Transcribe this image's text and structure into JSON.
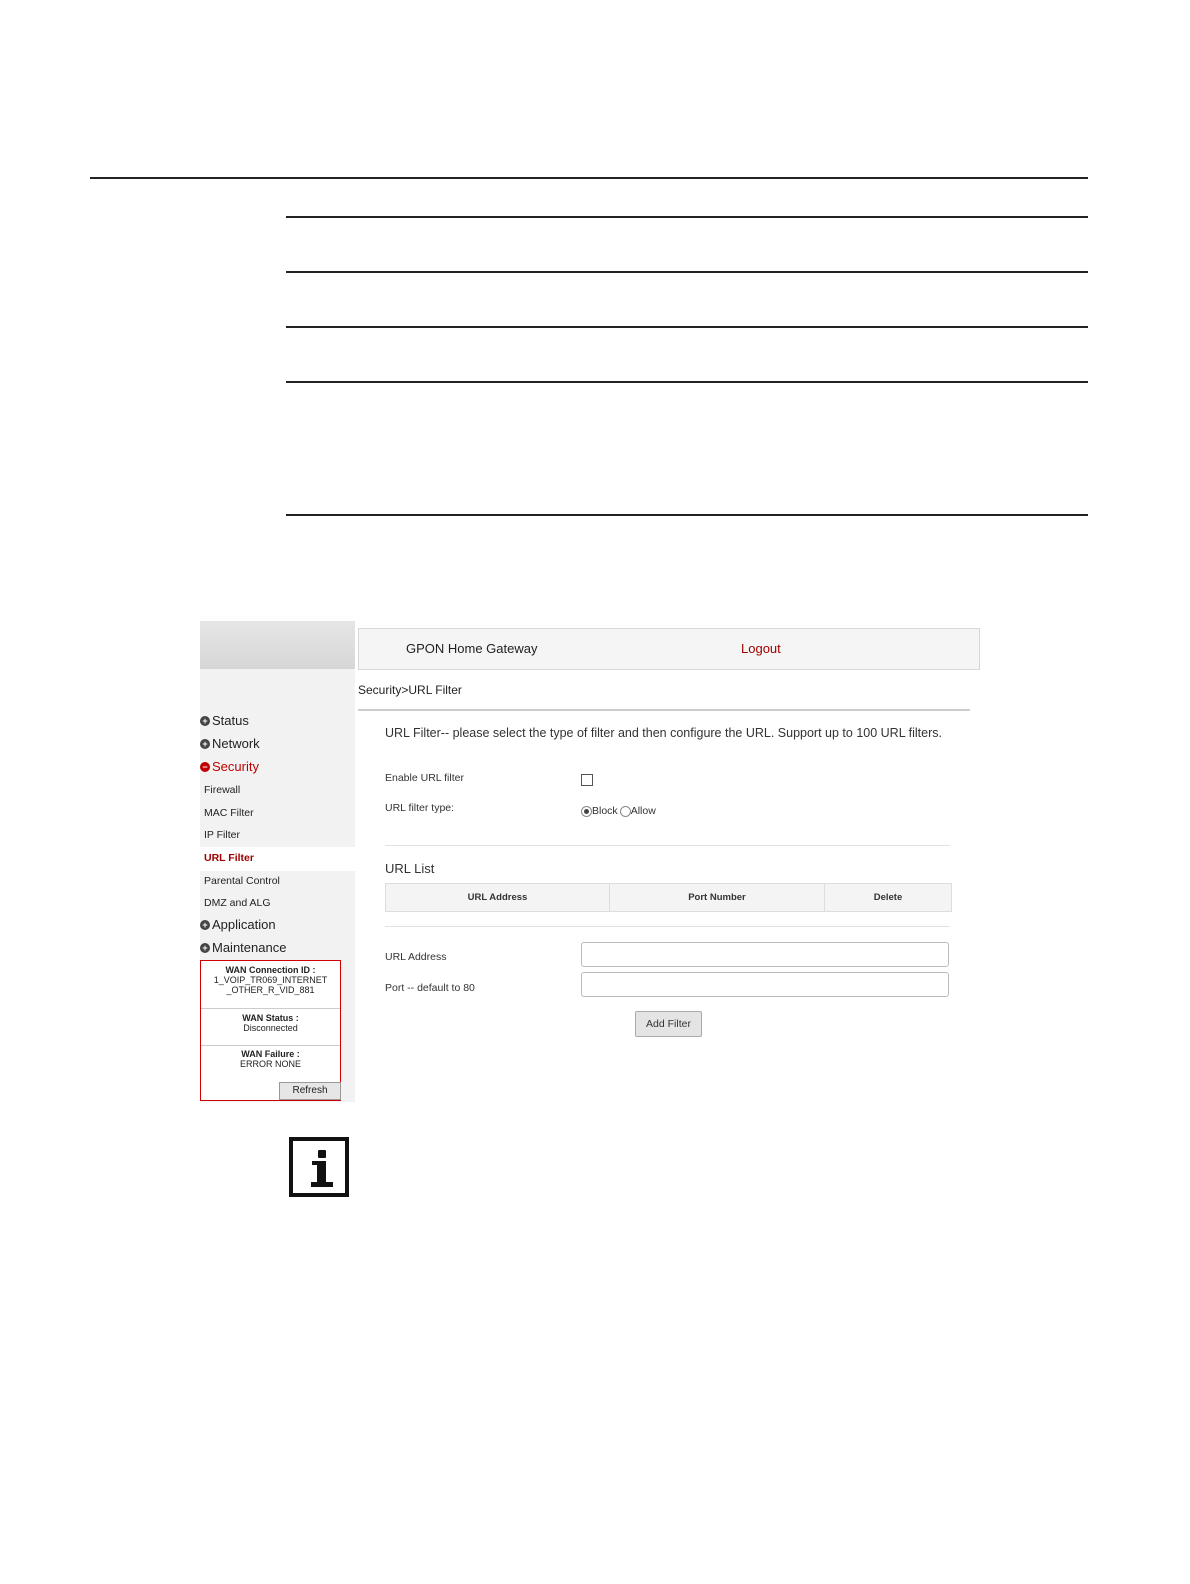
{
  "header": {
    "app_title": "GPON Home Gateway",
    "logout_label": "Logout"
  },
  "breadcrumb": "Security>URL Filter",
  "sidebar": {
    "items": [
      {
        "label": "Status"
      },
      {
        "label": "Network"
      },
      {
        "label": "Security"
      },
      {
        "label": "Application"
      },
      {
        "label": "Maintenance"
      }
    ],
    "sub_items": [
      {
        "label": "Firewall"
      },
      {
        "label": "MAC Filter"
      },
      {
        "label": "IP Filter"
      },
      {
        "label": "URL Filter"
      },
      {
        "label": "Parental Control"
      },
      {
        "label": "DMZ and ALG"
      }
    ]
  },
  "wan": {
    "connection_id_label": "WAN Connection ID :",
    "connection_id_line1": "1_VOIP_TR069_INTERNET",
    "connection_id_line2": "_OTHER_R_VID_881",
    "status_label": "WAN Status :",
    "status_value": "Disconnected",
    "failure_label": "WAN Failure :",
    "failure_value": "ERROR NONE",
    "refresh_label": "Refresh"
  },
  "main": {
    "description": "URL Filter-- please select the type of filter and then configure the URL. Support up to 100 URL filters.",
    "enable_label": "Enable URL filter",
    "enable_checked": false,
    "filter_type_label": "URL filter type:",
    "filter_type_options": [
      "Block",
      "Allow"
    ],
    "filter_type_selected": "Block",
    "url_list_title": "URL List",
    "table_headers": [
      "URL Address",
      "Port Number",
      "Delete"
    ],
    "url_address_label": "URL Address",
    "url_address_value": "",
    "port_label": "Port -- default to 80",
    "port_value": "",
    "add_button_label": "Add Filter"
  },
  "colors": {
    "accent": "#c00000",
    "logout": "#a00000"
  },
  "icons": {
    "note": "info-icon"
  }
}
